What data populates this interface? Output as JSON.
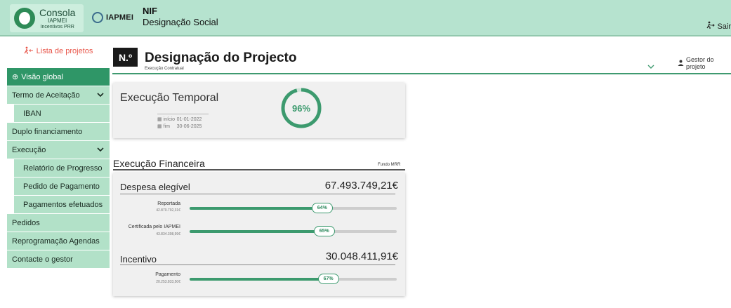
{
  "header": {
    "console_title": "Consola",
    "console_sub1": "IAPMEI",
    "console_sub2": "Incentivos PRR",
    "org_logo_text": "IAPMEI",
    "nif_label": "NIF",
    "company_name": "Designação Social",
    "logout_label": "Sair"
  },
  "sidebar": {
    "projects_link": "Lista de projetos",
    "items": [
      {
        "label": "Visão global",
        "active": true
      },
      {
        "label": "Termo de Aceitação",
        "expandable": true
      },
      {
        "label": "IBAN",
        "sub": true
      },
      {
        "label": "Duplo financiamento"
      },
      {
        "label": "Execução",
        "expandable": true
      },
      {
        "label": "Relatório de Progresso",
        "sub": true
      },
      {
        "label": "Pedido de Pagamento",
        "sub": true
      },
      {
        "label": "Pagamentos efetuados",
        "sub": true
      },
      {
        "label": "Pedidos"
      },
      {
        "label": "Reprogramação Agendas"
      },
      {
        "label": "Contacte o gestor"
      }
    ]
  },
  "project": {
    "number_badge": "N.º",
    "title": "Designação do Projecto",
    "status": "Execução Contratual",
    "gestor_label": "Gestor do projeto"
  },
  "temporal": {
    "title": "Execução Temporal",
    "start_label": "início",
    "start_date": "01-01-2022",
    "end_label": "fim",
    "end_date": "30-06-2025",
    "progress_text": "96%",
    "progress_fraction": 0.96
  },
  "financeira": {
    "title": "Execução Financeira",
    "fund": "Fundo MRR",
    "despesa": {
      "label": "Despesa elegível",
      "value": "67.493.749,21€",
      "bars": [
        {
          "label": "Reportada",
          "amount": "42.870.792,31€",
          "percent_text": "64%",
          "fraction": 0.64
        },
        {
          "label": "Certificada pelo IAPMEI",
          "amount": "43.834.398,99€",
          "percent_text": "65%",
          "fraction": 0.65
        }
      ]
    },
    "incentivo": {
      "label": "Incentivo",
      "value": "30.048.411,91€",
      "bars": [
        {
          "label": "Pagamento",
          "amount": "20.253.833,50€",
          "percent_text": "67%",
          "fraction": 0.67
        }
      ]
    }
  },
  "colors": {
    "header_bg": "#b6e3cf",
    "accent_green": "#3c9a6e",
    "sidebar_item_bg": "#b2e1c8",
    "sidebar_active_bg": "#2f9667",
    "projects_link": "#e8564a"
  },
  "icons": [
    "logout-icon",
    "projects-list-icon",
    "plus-circle-icon",
    "chevron-down-icon",
    "calendar-icon",
    "user-icon"
  ]
}
